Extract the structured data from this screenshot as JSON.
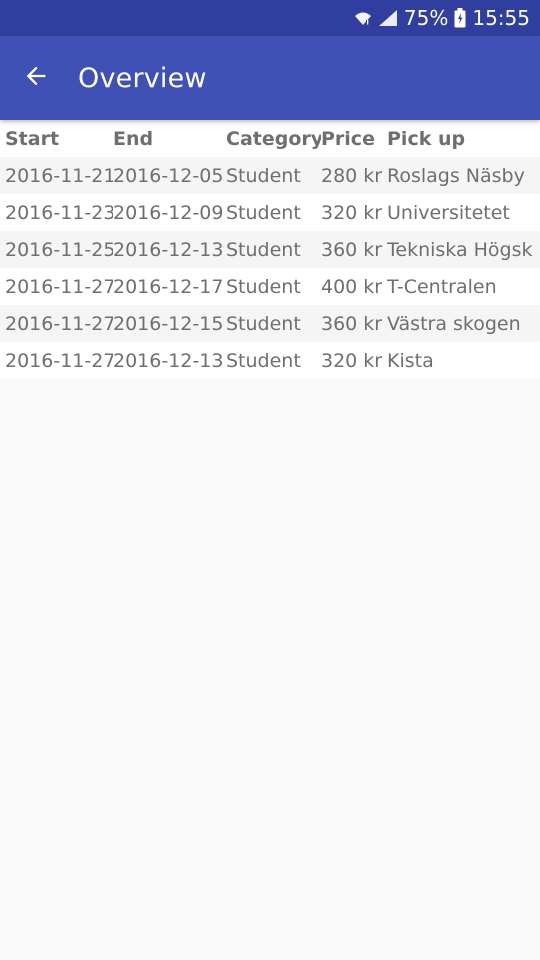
{
  "status_bar": {
    "battery": "75%",
    "time": "15:55",
    "icons": [
      "wifi-icon",
      "signal-icon",
      "battery-icon"
    ]
  },
  "app_bar": {
    "title": "Overview",
    "back_icon": "arrow-left-icon"
  },
  "table": {
    "headers": [
      "Start",
      "End",
      "Category",
      "Price",
      "Pick up"
    ],
    "rows": [
      [
        "2016-11-21",
        "2016-12-05",
        "Student",
        "280 kr",
        "Roslags Näsby"
      ],
      [
        "2016-11-23",
        "2016-12-09",
        "Student",
        "320 kr",
        "Universitetet"
      ],
      [
        "2016-11-25",
        "2016-12-13",
        "Student",
        "360 kr",
        "Tekniska Högsk"
      ],
      [
        "2016-11-27",
        "2016-12-17",
        "Student",
        "400 kr",
        "T-Centralen"
      ],
      [
        "2016-11-27",
        "2016-12-15",
        "Student",
        "360 kr",
        "Västra skogen"
      ],
      [
        "2016-11-27",
        "2016-12-13",
        "Student",
        "320 kr",
        "Kista"
      ]
    ]
  },
  "colors": {
    "status_bar": "#303f9f",
    "app_bar": "#3f51b5",
    "background": "#fafafa",
    "text": "#6f6f6f"
  }
}
